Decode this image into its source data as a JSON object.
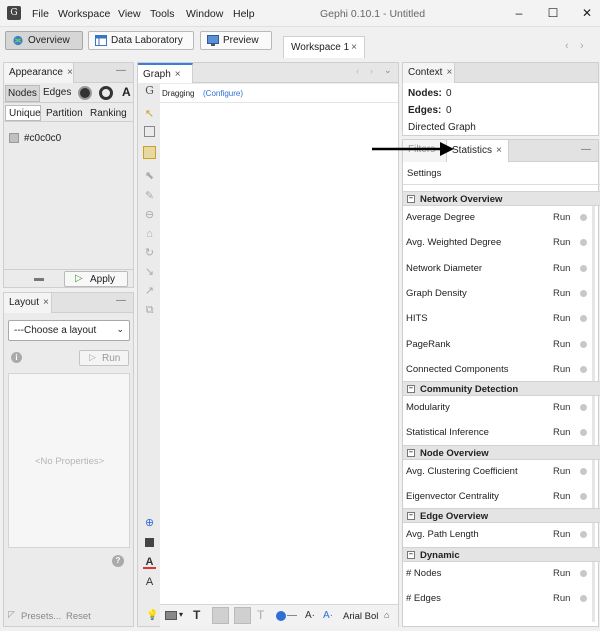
{
  "window": {
    "title": "Gephi 0.10.1 - Untitled",
    "menu": [
      "File",
      "Workspace",
      "View",
      "Tools",
      "Window",
      "Help"
    ],
    "controls": {
      "minimize": "–",
      "maximize": "☐",
      "close": "✕"
    }
  },
  "toolbar": {
    "overview": "Overview",
    "data_laboratory": "Data Laboratory",
    "preview": "Preview",
    "workspace_tab": "Workspace 1",
    "close": "×",
    "nav_prev": "‹",
    "nav_next": "›"
  },
  "appearance": {
    "tab": "Appearance",
    "target_tabs": [
      "Nodes",
      "Edges"
    ],
    "mode_tabs": [
      "Unique",
      "Partition",
      "Ranking"
    ],
    "color_value": "#c0c0c0",
    "apply": "Apply"
  },
  "layout": {
    "tab": "Layout",
    "select_placeholder": "---Choose a layout",
    "run": "Run",
    "no_properties": "<No Properties>",
    "presets": "Presets...",
    "reset": "Reset"
  },
  "graph": {
    "tab": "Graph",
    "mode": "Dragging",
    "configure": "(Configure)",
    "font_label": "Arial Bol"
  },
  "context": {
    "tab": "Context",
    "nodes_label": "Nodes:",
    "nodes_value": "0",
    "edges_label": "Edges:",
    "edges_value": "0",
    "graph_type": "Directed Graph"
  },
  "statistics": {
    "filters_tab": "Filters",
    "tab": "Statistics",
    "settings": "Settings",
    "run_label": "Run",
    "sections": [
      {
        "title": "Network Overview",
        "items": [
          "Average Degree",
          "Avg. Weighted Degree",
          "Network Diameter",
          "Graph Density",
          "HITS",
          "PageRank",
          "Connected Components"
        ]
      },
      {
        "title": "Community Detection",
        "items": [
          "Modularity",
          "Statistical Inference"
        ]
      },
      {
        "title": "Node Overview",
        "items": [
          "Avg. Clustering Coefficient",
          "Eigenvector Centrality"
        ]
      },
      {
        "title": "Edge Overview",
        "items": [
          "Avg. Path Length"
        ]
      },
      {
        "title": "Dynamic",
        "items": [
          "# Nodes",
          "# Edges"
        ]
      }
    ]
  },
  "colors": {
    "accent_blue": "#2f6fd6",
    "arrow": "#000000",
    "active_tab_line": "#3b7fd8"
  }
}
